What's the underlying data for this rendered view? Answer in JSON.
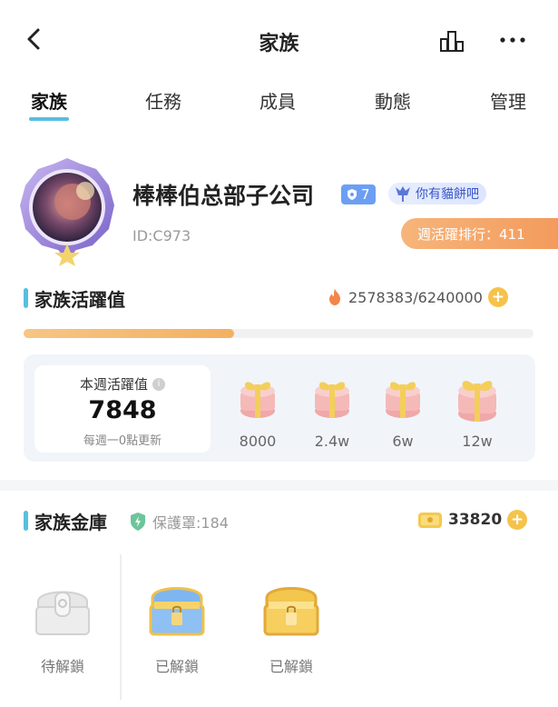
{
  "header": {
    "title": "家族",
    "back_icon": "chevron-left-icon",
    "rank_icon": "bar-chart-icon",
    "more_icon": "more-horizontal-icon"
  },
  "tabs": [
    {
      "label": "家族",
      "active": true
    },
    {
      "label": "任務",
      "active": false
    },
    {
      "label": "成員",
      "active": false
    },
    {
      "label": "動態",
      "active": false
    },
    {
      "label": "管理",
      "active": false
    }
  ],
  "profile": {
    "name": "棒棒伯总部子公司",
    "level": "7",
    "tag": "你有貓餅吧",
    "id": "ID:C973",
    "weekly_rank": "週活躍排行：411"
  },
  "activity": {
    "title": "家族活躍值",
    "value": "2578383/6240000",
    "progress_fraction": 0.413,
    "weekly_label": "本週活躍值",
    "weekly_value": "7848",
    "weekly_note": "每週一0點更新",
    "rewards": [
      {
        "label": "8000"
      },
      {
        "label": "2.4w"
      },
      {
        "label": "6w"
      },
      {
        "label": "12w"
      }
    ]
  },
  "vault": {
    "title": "家族金庫",
    "shield_text": "保護罩:184",
    "gold": "33820",
    "chests": [
      {
        "label": "待解鎖",
        "style": "grey"
      },
      {
        "label": "已解鎖",
        "style": "blue"
      },
      {
        "label": "已解鎖",
        "style": "gold"
      }
    ]
  },
  "colors": {
    "accent": "#58bfe0",
    "rank_pill": "#f39b5d",
    "gold": "#f5c34a",
    "level_badge": "#6c9ff4"
  }
}
